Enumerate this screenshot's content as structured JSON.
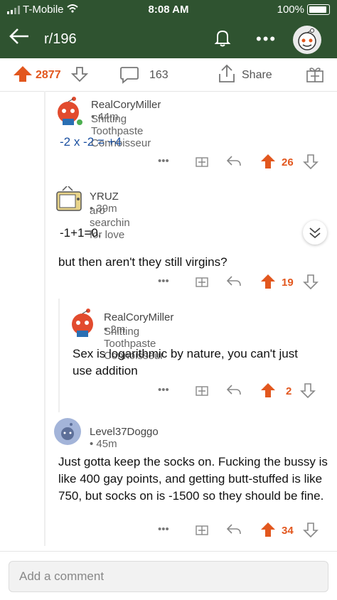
{
  "status": {
    "carrier": "T-Mobile",
    "time": "8:08 AM",
    "battery": "100%"
  },
  "nav": {
    "back_icon": "arrow-left-icon",
    "subreddit": "r/196"
  },
  "actions": {
    "score": "2877",
    "comments": "163",
    "share": "Share"
  },
  "comments": [
    {
      "user": "RealCoryMiller",
      "age": "44m",
      "flair": "Shitting Toothpaste Connoisseur",
      "body": [
        "-2 x -2 = +4"
      ],
      "score": "26"
    },
    {
      "user": "YRUZ",
      "age": "39m",
      "flair": "aro searchin for love",
      "body": [
        "-1+1=0.",
        "but then aren't they still virgins?"
      ],
      "score": "19"
    },
    {
      "user": "RealCoryMiller",
      "age": "2m",
      "flair": "Shitting Toothpaste Connoisseur",
      "body": [
        "Sex is logarithmic by nature, you can't just use addition"
      ],
      "score": "2"
    },
    {
      "user": "Level37Doggo",
      "age": "45m",
      "flair": "",
      "body": [
        "Just gotta keep the socks on. Fucking the bussy is like 400 gay points, and getting butt-stuffed is like 750, but socks on is -1500 so they should be fine."
      ],
      "score": "34"
    }
  ],
  "compose": {
    "placeholder": "Add a comment"
  },
  "colors": {
    "header": "#2f5330",
    "upvote": "#e2571e",
    "link": "#1a4fa0"
  }
}
